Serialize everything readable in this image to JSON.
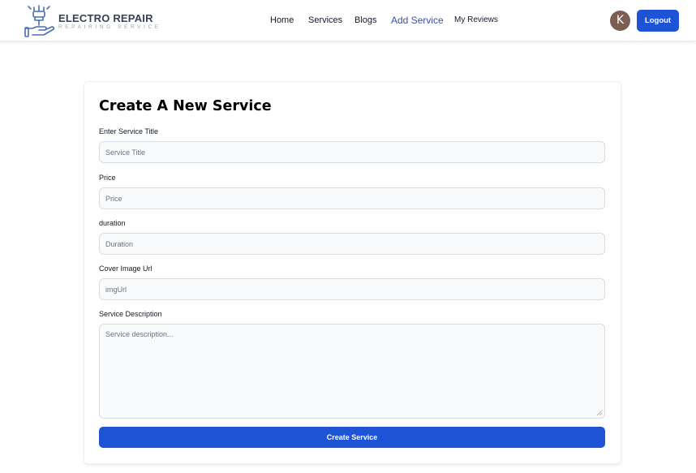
{
  "navbar": {
    "logo": {
      "title": "ELECTRO REPAIR",
      "subtitle": "REPAIRING SERVICE",
      "icon": "hand-plug-logo-icon"
    },
    "links": [
      {
        "label": "Home"
      },
      {
        "label": "Services"
      },
      {
        "label": "Blogs"
      },
      {
        "label": "Add Service",
        "active": true
      },
      {
        "label": "My Reviews"
      }
    ],
    "avatar_initial": "K",
    "logout_label": "Logout"
  },
  "form": {
    "title": "Create A New Service",
    "fields": {
      "title": {
        "label": "Enter Service Title",
        "placeholder": "Service Title",
        "value": ""
      },
      "price": {
        "label": "Price",
        "placeholder": "Price",
        "value": ""
      },
      "duration": {
        "label": "duration",
        "placeholder": "Duration",
        "value": ""
      },
      "image": {
        "label": "Cover Image Url",
        "placeholder": "imgUrl",
        "value": ""
      },
      "description": {
        "label": "Service Description",
        "placeholder": "Service description...",
        "value": ""
      }
    },
    "submit_label": "Create Service"
  },
  "colors": {
    "primary": "#1e53d6",
    "active_link": "#3b4fb0",
    "avatar_bg": "#7d5e53",
    "input_bg": "#f9fafb",
    "logo_text": "#374151",
    "logo_icon": "#4a6fb0"
  }
}
